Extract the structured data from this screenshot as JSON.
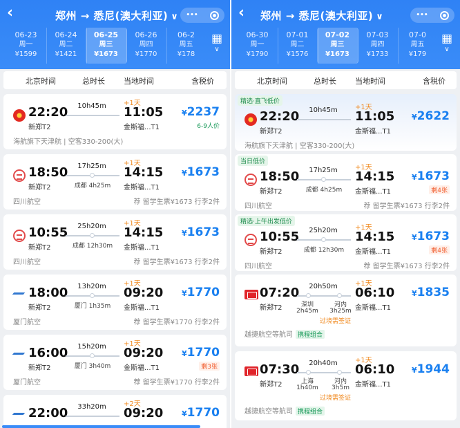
{
  "left": {
    "title": "郑州 → 悉尼(澳大利亚)",
    "dates": [
      {
        "date": "06-23",
        "weekday": "周一",
        "price": "¥1599",
        "selected": false
      },
      {
        "date": "06-24",
        "weekday": "周二",
        "price": "¥1421",
        "selected": false
      },
      {
        "date": "06-25",
        "weekday": "周三",
        "price": "¥1673",
        "selected": true
      },
      {
        "date": "06-26",
        "weekday": "周四",
        "price": "¥1770",
        "selected": false
      },
      {
        "date": "06-2",
        "weekday": "周五",
        "price": "¥178",
        "selected": false
      }
    ],
    "columns": {
      "dep": "北京时间",
      "dur": "总时长",
      "arr": "当地时间",
      "price": "含税价"
    },
    "flights": [
      {
        "dep": "22:20",
        "dep_term": "新郑T2",
        "dur": "10h45m",
        "stop": "",
        "arr": "11:05",
        "arr_day": "+1天",
        "arr_apt": "金斯福...T1",
        "price": "2237",
        "price_note": "6-9人价",
        "airline": "海航旗下天津航",
        "aircraft": "空客330-200(大)",
        "rec": "",
        "logo": "hn"
      },
      {
        "dep": "18:50",
        "dep_term": "新郑T2",
        "dur": "17h25m",
        "stop": "成都 4h25m",
        "arr": "14:15",
        "arr_day": "+1天",
        "arr_apt": "金斯福...T1",
        "price": "1673",
        "price_note": "",
        "airline": "四川航空",
        "aircraft": "",
        "rec": "荐 留学生票¥1673 行李2件",
        "logo": "sc"
      },
      {
        "dep": "10:55",
        "dep_term": "新郑T2",
        "dur": "25h20m",
        "stop": "成都 12h30m",
        "arr": "14:15",
        "arr_day": "+1天",
        "arr_apt": "金斯福...T1",
        "price": "1673",
        "price_note": "",
        "airline": "四川航空",
        "aircraft": "",
        "rec": "荐 留学生票¥1673 行李2件",
        "logo": "sc"
      },
      {
        "dep": "18:00",
        "dep_term": "新郑T2",
        "dur": "13h20m",
        "stop": "厦门 1h35m",
        "arr": "09:20",
        "arr_day": "+1天",
        "arr_apt": "金斯福...T1",
        "price": "1770",
        "price_note": "",
        "airline": "厦门航空",
        "aircraft": "",
        "rec": "荐 留学生票¥1770 行李2件",
        "logo": "xm"
      },
      {
        "dep": "16:00",
        "dep_term": "新郑T2",
        "dur": "15h20m",
        "stop": "厦门 3h40m",
        "arr": "09:20",
        "arr_day": "+1天",
        "arr_apt": "金斯福...T1",
        "price": "1770",
        "price_note": "剩3张",
        "airline": "厦门航空",
        "aircraft": "",
        "rec": "荐 留学生票¥1770 行李2件",
        "logo": "xm"
      },
      {
        "dep": "22:00",
        "dep_term": "",
        "dur": "33h20m",
        "stop": "",
        "arr": "09:20",
        "arr_day": "+2天",
        "arr_apt": "",
        "price": "1770",
        "price_note": "",
        "airline": "",
        "aircraft": "",
        "rec": "",
        "logo": "xm"
      }
    ]
  },
  "right": {
    "title": "郑州 → 悉尼(澳大利亚)",
    "dates": [
      {
        "date": "06-30",
        "weekday": "周一",
        "price": "¥1790",
        "selected": false
      },
      {
        "date": "07-01",
        "weekday": "周二",
        "price": "¥1576",
        "selected": false
      },
      {
        "date": "07-02",
        "weekday": "周三",
        "price": "¥1673",
        "selected": true
      },
      {
        "date": "07-03",
        "weekday": "周四",
        "price": "¥1733",
        "selected": false
      },
      {
        "date": "07-0",
        "weekday": "周五",
        "price": "¥179",
        "selected": false
      }
    ],
    "columns": {
      "dep": "北京时间",
      "dur": "总时长",
      "arr": "当地时间",
      "price": "含税价"
    },
    "flights": [
      {
        "tag": "精选·直飞低价",
        "dep": "22:20",
        "dep_term": "新郑T2",
        "dur": "10h45m",
        "stop": "",
        "arr": "11:05",
        "arr_day": "+1天",
        "arr_apt": "金斯福...T1",
        "price": "2622",
        "price_note": "",
        "airline": "海航旗下天津航",
        "aircraft": "空客330-200(大)",
        "rec": "",
        "logo": "hn"
      },
      {
        "tag": "当日低价",
        "dep": "18:50",
        "dep_term": "新郑T2",
        "dur": "17h25m",
        "stop": "成都 4h25m",
        "arr": "14:15",
        "arr_day": "+1天",
        "arr_apt": "金斯福...T1",
        "price": "1673",
        "price_note": "剩4张",
        "airline": "四川航空",
        "aircraft": "",
        "rec": "荐 留学生票¥1673 行李2件",
        "logo": "sc"
      },
      {
        "tag": "精选·上午出发低价",
        "dep": "10:55",
        "dep_term": "新郑T2",
        "dur": "25h20m",
        "stop": "成都 12h30m",
        "arr": "14:15",
        "arr_day": "+1天",
        "arr_apt": "金斯福...T1",
        "price": "1673",
        "price_note": "剩4张",
        "airline": "四川航空",
        "aircraft": "",
        "rec": "荐 留学生票¥1673 行李2件",
        "logo": "sc"
      },
      {
        "tag": "",
        "dep": "07:20",
        "dep_term": "新郑T2",
        "dur": "20h50m",
        "stop1": "深圳",
        "stop1t": "2h45m",
        "stop2": "河内",
        "stop2t": "3h25m",
        "visa": "过境需签证",
        "arr": "06:10",
        "arr_day": "+1天",
        "arr_apt": "金斯福...T1",
        "price": "1835",
        "price_note": "",
        "airline": "越捷航空等航司",
        "combo": "携程组合",
        "rec": "",
        "logo": "vj"
      },
      {
        "tag": "",
        "dep": "07:30",
        "dep_term": "新郑T2",
        "dur": "20h40m",
        "stop1": "上海",
        "stop1t": "1h40m",
        "stop2": "河内",
        "stop2t": "3h5m",
        "visa": "过境需签证",
        "arr": "06:10",
        "arr_day": "+1天",
        "arr_apt": "金斯福...T1",
        "price": "1944",
        "price_note": "",
        "airline": "越捷航空等航司",
        "combo": "携程组合",
        "rec": "",
        "logo": "vj"
      }
    ]
  },
  "icons": {
    "back": "back-arrow-icon",
    "more": "more-dots-icon",
    "target": "target-icon",
    "calendar": "calendar-icon"
  },
  "colors": {
    "brand": "#2f82f5",
    "price": "#1a80f0",
    "tail": "#f08a20",
    "tag": "#1a8a4a"
  }
}
